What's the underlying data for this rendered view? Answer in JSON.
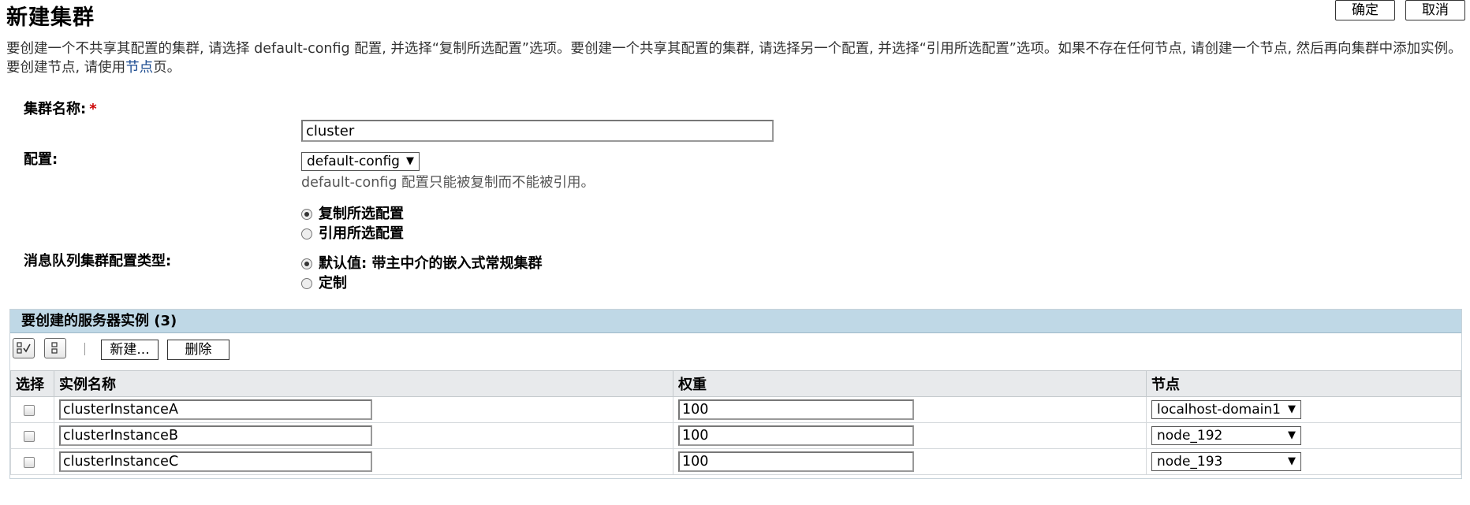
{
  "page": {
    "title": "新建集群",
    "ok_label": "确定",
    "cancel_label": "取消",
    "help_text_before_link": "要创建一个不共享其配置的集群, 请选择 default-config 配置, 并选择“复制所选配置”选项。要创建一个共享其配置的集群, 请选择另一个配置, 并选择“引用所选配置”选项。如果不存在任何节点, 请创建一个节点, 然后再向集群中添加实例。要创建节点, 请使用",
    "help_link": "节点",
    "help_text_after_link": "页。"
  },
  "form": {
    "cluster_name_label": "集群名称:",
    "required_mark": "*",
    "cluster_name_value": "cluster",
    "config_label": "配置:",
    "config_selected": "default-config",
    "config_note": "default-config 配置只能被复制而不能被引用。",
    "copy_option": "复制所选配置",
    "reference_option": "引用所选配置",
    "mq_label": "消息队列集群配置类型:",
    "mq_default_option": "默认值: 带主中介的嵌入式常规集群",
    "mq_custom_option": "定制"
  },
  "instances": {
    "title": "要创建的服务器实例 (3)",
    "new_label": "新建...",
    "delete_label": "删除",
    "columns": [
      "选择",
      "实例名称",
      "权重",
      "节点"
    ],
    "rows": [
      {
        "name": "clusterInstanceA",
        "weight": "100",
        "node": "localhost-domain1"
      },
      {
        "name": "clusterInstanceB",
        "weight": "100",
        "node": "node_192"
      },
      {
        "name": "clusterInstanceC",
        "weight": "100",
        "node": "node_193"
      }
    ]
  },
  "icons": [
    "select-all-icon",
    "deselect-all-icon",
    "dropdown-arrow-icon"
  ],
  "colors": {
    "table_header_bg": "#bfd8e6",
    "link": "#1a4a8f",
    "required": "#cc0000"
  }
}
